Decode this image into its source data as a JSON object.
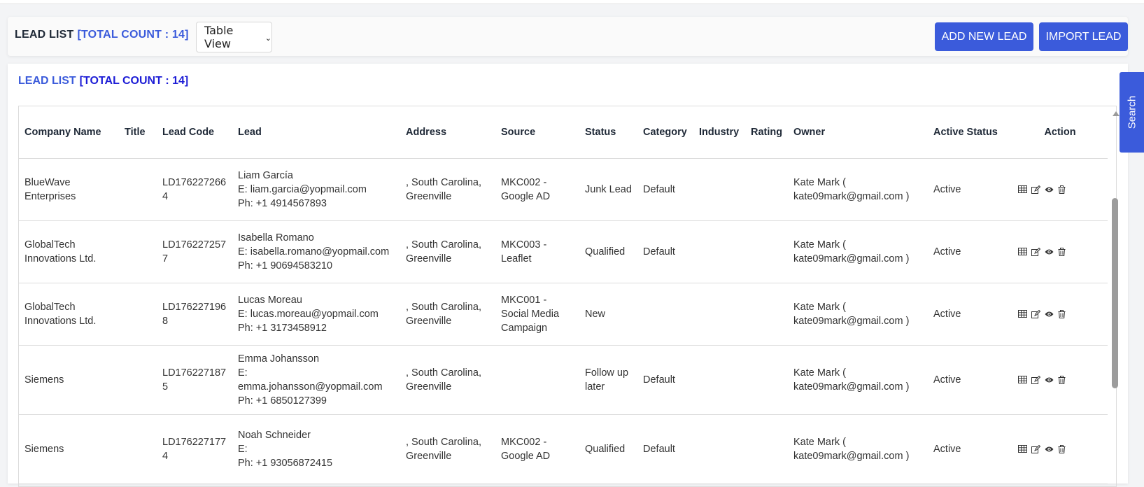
{
  "header": {
    "title": "LEAD LIST",
    "count_label": "[TOTAL COUNT : 14]",
    "view_select": "Table View",
    "add_button": "ADD NEW LEAD",
    "import_button": "IMPORT LEAD"
  },
  "list": {
    "title": "LEAD LIST",
    "count_label": "[TOTAL COUNT : 14]"
  },
  "table": {
    "columns": [
      "Company Name",
      "Title",
      "Lead Code",
      "Lead",
      "Address",
      "Source",
      "Status",
      "Category",
      "Industry",
      "Rating",
      "Owner",
      "Active Status",
      "Action"
    ],
    "rows": [
      {
        "company": "BlueWave Enterprises",
        "title": "",
        "lead_code": "LD1762272664",
        "lead_name": "Liam García",
        "lead_email": "E: liam.garcia@yopmail.com",
        "lead_phone": "Ph: +1 4914567893",
        "address": ", South Carolina, Greenville",
        "source": "MKC002 - Google AD",
        "status": "Junk Lead",
        "category": "Default",
        "industry": "",
        "rating": "",
        "owner": "Kate Mark ( kate09mark@gmail.com )",
        "active_status": "Active"
      },
      {
        "company": "GlobalTech Innovations Ltd.",
        "title": "",
        "lead_code": "LD1762272577",
        "lead_name": "Isabella Romano",
        "lead_email": "E: isabella.romano@yopmail.com",
        "lead_phone": "Ph: +1 90694583210",
        "address": ", South Carolina, Greenville",
        "source": "MKC003 - Leaflet",
        "status": "Qualified",
        "category": "Default",
        "industry": "",
        "rating": "",
        "owner": "Kate Mark ( kate09mark@gmail.com )",
        "active_status": "Active"
      },
      {
        "company": "GlobalTech Innovations Ltd.",
        "title": "",
        "lead_code": "LD1762271968",
        "lead_name": "Lucas Moreau",
        "lead_email": "E: lucas.moreau@yopmail.com",
        "lead_phone": "Ph: +1 3173458912",
        "address": ", South Carolina, Greenville",
        "source": "MKC001 - Social Media Campaign",
        "status": "New",
        "category": "",
        "industry": "",
        "rating": "",
        "owner": "Kate Mark ( kate09mark@gmail.com )",
        "active_status": "Active"
      },
      {
        "company": "Siemens",
        "title": "",
        "lead_code": "LD1762271875",
        "lead_name": "Emma Johansson",
        "lead_email": "E: emma.johansson@yopmail.com",
        "lead_phone": "Ph: +1 6850127399",
        "address": ", South Carolina, Greenville",
        "source": "",
        "status": "Follow up later",
        "category": "Default",
        "industry": "",
        "rating": "",
        "owner": "Kate Mark ( kate09mark@gmail.com )",
        "active_status": "Active"
      },
      {
        "company": "Siemens",
        "title": "",
        "lead_code": "LD1762271774",
        "lead_name": "Noah Schneider",
        "lead_email": "E:",
        "lead_phone": "Ph: +1 93056872415",
        "address": ", South Carolina, Greenville",
        "source": "MKC002 - Google AD",
        "status": "Qualified",
        "category": "Default",
        "industry": "",
        "rating": "",
        "owner": "Kate Mark ( kate09mark@gmail.com )",
        "active_status": "Active"
      }
    ]
  },
  "search_tab": "Search",
  "icons": {
    "row_actions": [
      "table-icon",
      "edit-icon",
      "eye-icon",
      "trash-icon"
    ]
  },
  "colors": {
    "primary": "#3b5bdb",
    "count_dark_blue": "#1d1dd6"
  }
}
